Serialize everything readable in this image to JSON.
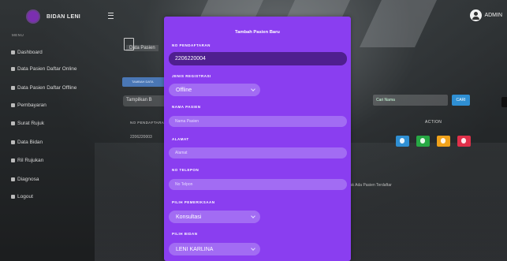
{
  "app": {
    "brand": "BIDAN LENI",
    "user": "ADMIN"
  },
  "sidebar": {
    "header": "MENU",
    "items": [
      {
        "label": "Dashboard",
        "icon": "dashboard-icon"
      },
      {
        "label": "Data Pasien Daftar Online",
        "icon": "users-icon"
      },
      {
        "label": "Data Pasien Daftar Offline",
        "icon": "users-icon"
      },
      {
        "label": "Pembayaran",
        "icon": "money-icon"
      },
      {
        "label": "Surat Rujuk",
        "icon": "document-icon"
      },
      {
        "label": "Data Bidan",
        "icon": "user-icon"
      },
      {
        "label": "Ril Rujukan",
        "icon": "chart-icon"
      },
      {
        "label": "Diagnosa",
        "icon": "stethoscope-icon"
      },
      {
        "label": "Logout",
        "icon": "logout-icon"
      }
    ]
  },
  "background": {
    "page_title": "Data Pasien",
    "add_button": "TAMBAH DATA",
    "show_select": "Tampilkan B",
    "search_placeholder": "Cari Nama",
    "search_button": "CARI",
    "col_reg": "NO PENDAFTARAN",
    "col_action": "ACTION",
    "row_reg": "2206220003",
    "footer": "Tidak Ada Pasien Terdaftar"
  },
  "modal": {
    "title": "Tambah Pasien Baru",
    "fields": {
      "no_pendaftaran": {
        "label": "NO PENDAFTARAN",
        "value": "2206220004"
      },
      "jenis_registrasi": {
        "label": "JENIS REGISTRASI",
        "value": "Offline"
      },
      "nama_pasien": {
        "label": "NAMA PASIEN",
        "placeholder": "Nama Pasien"
      },
      "alamat": {
        "label": "ALAMAT",
        "placeholder": "Alamat"
      },
      "no_telepon": {
        "label": "NO TELEPON",
        "placeholder": "No Telpon"
      },
      "pilih_pemeriksaan": {
        "label": "PILIH PEMERIKSAAN",
        "value": "Konsultasi"
      },
      "pilih_bidan": {
        "label": "PILIH BIDAN",
        "value": "LENI KARLINA"
      }
    }
  },
  "colors": {
    "modal_bg": "#8a3ef0",
    "input_bg": "#a26cf3",
    "input_dark": "#4f1f8f",
    "action_info": "#2f8fd3",
    "action_print": "#27a844",
    "action_edit": "#f0a21b",
    "action_delete": "#e0304a"
  }
}
